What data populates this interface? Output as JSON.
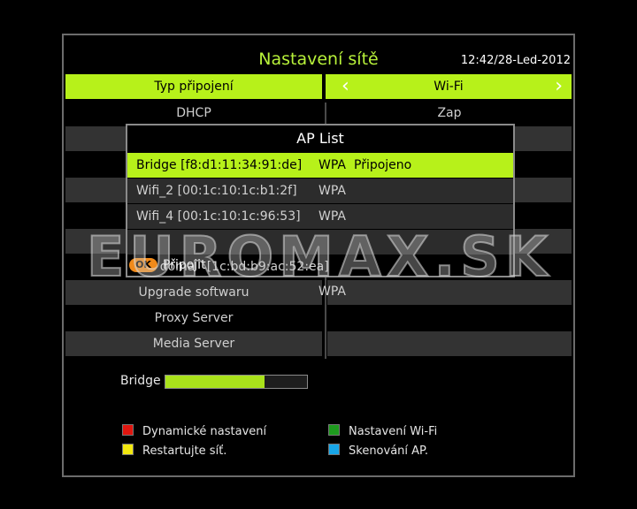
{
  "header": {
    "title": "Nastavení sítě",
    "datetime": "12:42/28-Led-2012"
  },
  "connection": {
    "label": "Typ připojení",
    "value": "Wi-Fi"
  },
  "rows": [
    {
      "label": "DHCP",
      "value": "Zap"
    },
    {
      "label": "",
      "value": ""
    },
    {
      "label": "",
      "value": ""
    },
    {
      "label": "",
      "value": ""
    },
    {
      "label": "",
      "value": ""
    },
    {
      "label": "",
      "value": ""
    },
    {
      "label": "",
      "value": ""
    },
    {
      "label": "Upgrade softwaru",
      "value": ""
    },
    {
      "label": "Proxy Server",
      "value": ""
    },
    {
      "label": "Media Server",
      "value": ""
    }
  ],
  "ap_popup": {
    "title": "AP List",
    "items": [
      {
        "name": "Bridge [f8:d1:11:34:91:de]",
        "security": "WPA",
        "status": "Připojeno"
      },
      {
        "name": "Wifi_2 [00:1c:10:1c:b1:2f]",
        "security": "WPA",
        "status": ""
      },
      {
        "name": "Wifi_4 [00:1c:10:1c:96:53]",
        "security": "WPA",
        "status": ""
      },
      {
        "name": "doma   [1c:bd:b9:ac:52:ea]",
        "security": "WPA",
        "status": ""
      }
    ],
    "ok_label": "OK",
    "connect_label": "Připojit"
  },
  "signal": {
    "label": "Bridge",
    "level_percent": 70
  },
  "legend": {
    "red": "Dynamické nastavení",
    "yellow": "Restartujte síť.",
    "green": "Nastavení Wi-Fi",
    "blue": "Skenování AP."
  },
  "watermark": "EUROMAX.SK",
  "colors": {
    "accent": "#b7f11a",
    "red": "#e0160f",
    "yellow": "#f2e80f",
    "green": "#1e9a1e",
    "blue": "#18a6e8"
  }
}
